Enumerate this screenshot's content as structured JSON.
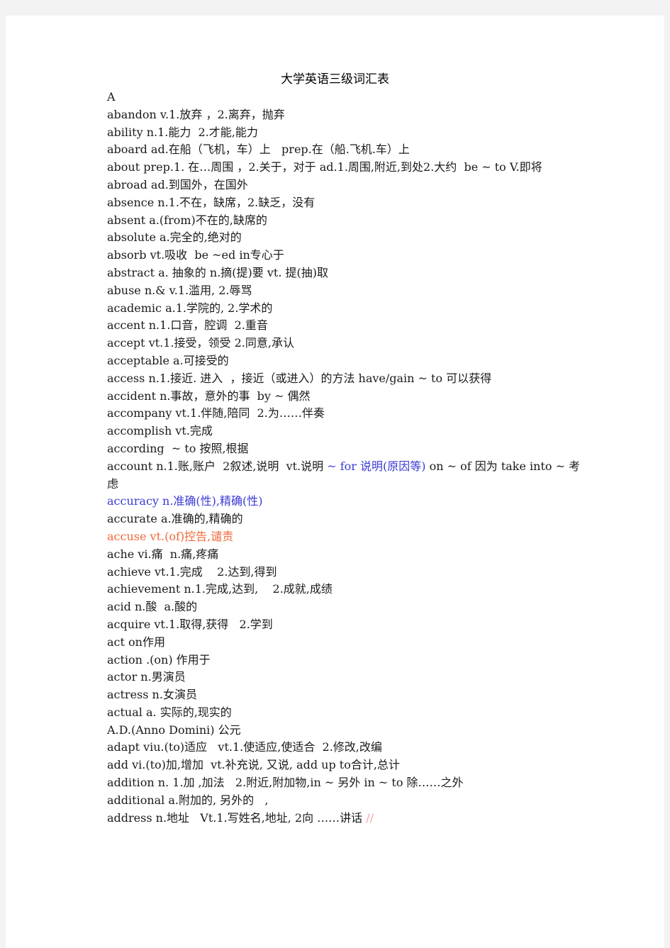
{
  "document": {
    "title": "大学英语三级词汇表",
    "section_letter": "A",
    "entries": [
      {
        "text": "abandon v.1.放弃 ，2.离弃，抛弃"
      },
      {
        "text": "ability n.1.能力  2.才能,能力"
      },
      {
        "text": "aboard ad.在船（飞机，车）上   prep.在（船.飞机.车）上"
      },
      {
        "text": "about prep.1. 在…周围 ，2.关于，对于 ad.1.周围,附近,到处2.大约  be ~ to V.即将"
      },
      {
        "text": "abroad ad.到国外，在国外"
      },
      {
        "text": "absence n.1.不在，缺席，2.缺乏，没有"
      },
      {
        "text": "absent a.(from)不在的,缺席的"
      },
      {
        "text": "absolute a.完全的,绝对的"
      },
      {
        "text": "absorb vt.吸收  be ~ed in专心于"
      },
      {
        "text": "abstract a. 抽象的 n.摘(提)要 vt. 提(抽)取"
      },
      {
        "text": "abuse n.& v.1.滥用, 2.辱骂"
      },
      {
        "text": "academic a.1.学院的, 2.学术的"
      },
      {
        "text": "accent n.1.口音，腔调  2.重音"
      },
      {
        "text": "accept vt.1.接受，领受 2.同意,承认"
      },
      {
        "text": "acceptable a.可接受的"
      },
      {
        "text": "access n.1.接近. 进入  ，接近（或进入）的方法 have/gain ~ to 可以获得"
      },
      {
        "text": "accident n.事故，意外的事  by ~ 偶然"
      },
      {
        "text": "accompany vt.1.伴随,陪同  2.为……伴奏"
      },
      {
        "text": "accomplish vt.完成"
      },
      {
        "text": "according  ~ to 按照,根据"
      },
      {
        "text_before": "account n.1.账,账户  2叙述,说明  vt.说明 ",
        "text_blue": "~ for 说明(原因等)",
        "text_after": " on ~ of 因为 take into ~ 考虑"
      },
      {
        "text": "accuracy n.准确(性),精确(性)",
        "color": "blue"
      },
      {
        "text": "accurate a.准确的,精确的"
      },
      {
        "text": "accuse vt.(of)控告,谴责",
        "color": "orange"
      },
      {
        "text": "ache vi.痛  n.痛,疼痛"
      },
      {
        "text": "achieve vt.1.完成    2.达到,得到"
      },
      {
        "text": "achievement n.1.完成,达到,    2.成就,成绩"
      },
      {
        "text": "acid n.酸  a.酸的"
      },
      {
        "text": "acquire vt.1.取得,获得   2.学到"
      },
      {
        "text": "act on作用"
      },
      {
        "text": "action .(on) 作用于"
      },
      {
        "text": "actor n.男演员"
      },
      {
        "text": "actress n.女演员"
      },
      {
        "text": "actual a. 实际的,现实的"
      },
      {
        "text": "A.D.(Anno Domini) 公元"
      },
      {
        "text": "adapt viu.(to)适应   vt.1.使适应,使适合  2.修改,改编"
      },
      {
        "text": "add vi.(to)加,增加  vt.补充说, 又说, add up to合计,总计"
      },
      {
        "text": "addition n. 1.加 ,加法   2.附近,附加物,in ~ 另外 in ~ to 除……之外"
      },
      {
        "text": "additional a.附加的, 另外的   ,"
      },
      {
        "text_before": "address n.地址   Vt.1.写姓名,地址, 2向 ……讲话 ",
        "text_pink": "//"
      }
    ]
  }
}
